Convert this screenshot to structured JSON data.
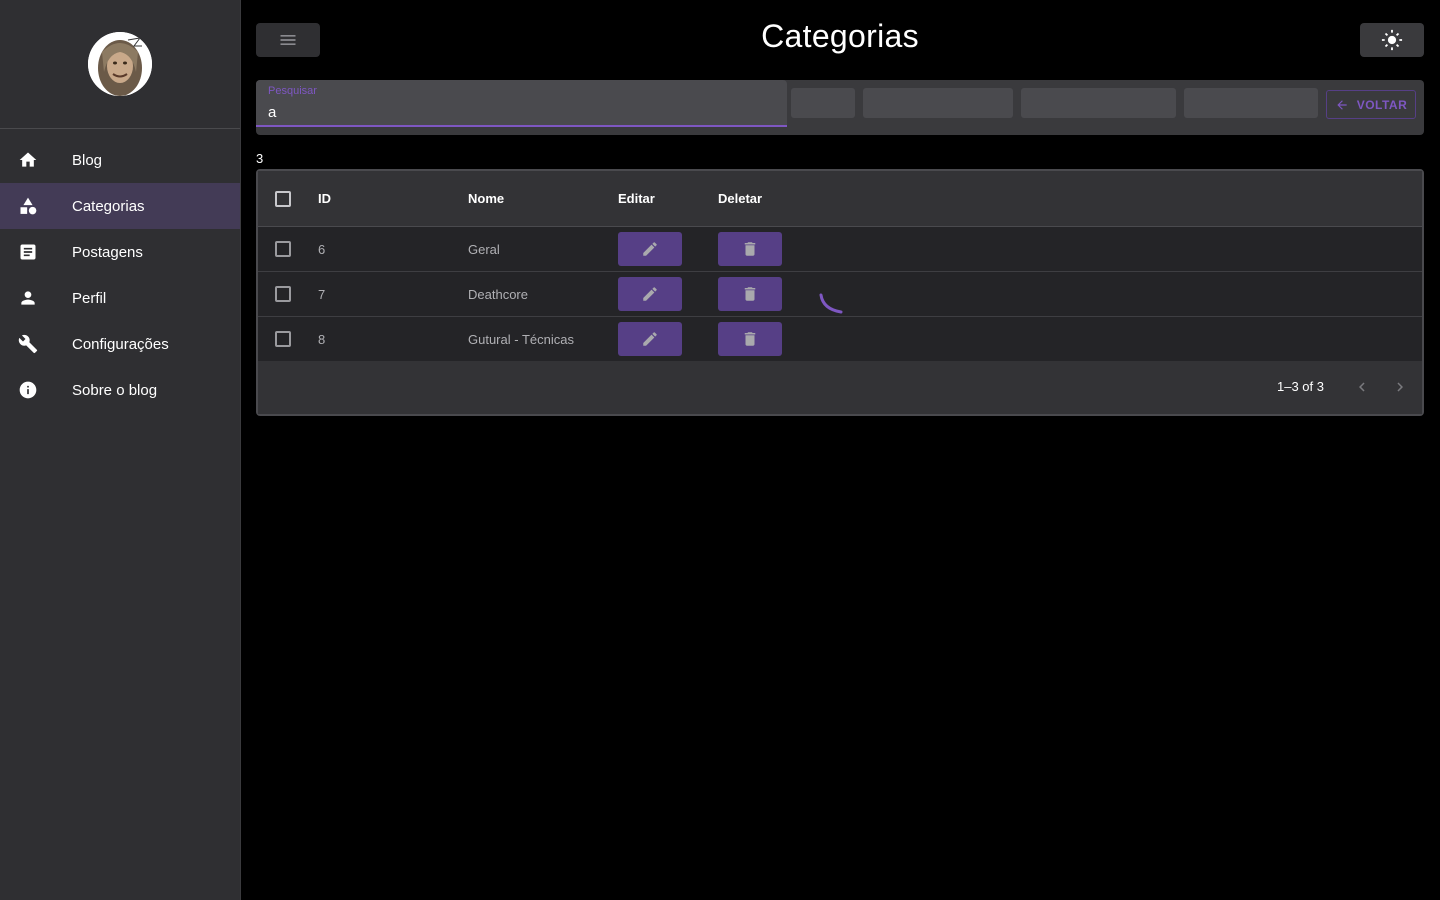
{
  "sidebar": {
    "items": [
      {
        "label": "Blog",
        "icon": "home-icon"
      },
      {
        "label": "Categorias",
        "icon": "category-icon",
        "active": true
      },
      {
        "label": "Postagens",
        "icon": "article-icon"
      },
      {
        "label": "Perfil",
        "icon": "person-icon"
      },
      {
        "label": "Configurações",
        "icon": "wrench-icon"
      },
      {
        "label": "Sobre o blog",
        "icon": "info-icon"
      }
    ]
  },
  "header": {
    "title": "Categorias"
  },
  "toolbar": {
    "search_label": "Pesquisar",
    "search_value": "a",
    "back_label": "VOLTAR"
  },
  "result_count": "3",
  "table": {
    "columns": {
      "id": "ID",
      "name": "Nome",
      "edit": "Editar",
      "delete": "Deletar"
    },
    "rows": [
      {
        "id": "6",
        "name": "Geral"
      },
      {
        "id": "7",
        "name": "Deathcore"
      },
      {
        "id": "8",
        "name": "Gutural - Técnicas"
      }
    ],
    "pagination": "1–3 of 3"
  },
  "colors": {
    "accent": "#7e57c2",
    "button": "#563f86",
    "sidebar_bg": "#2f2f32",
    "active_item_bg": "#433b56"
  }
}
